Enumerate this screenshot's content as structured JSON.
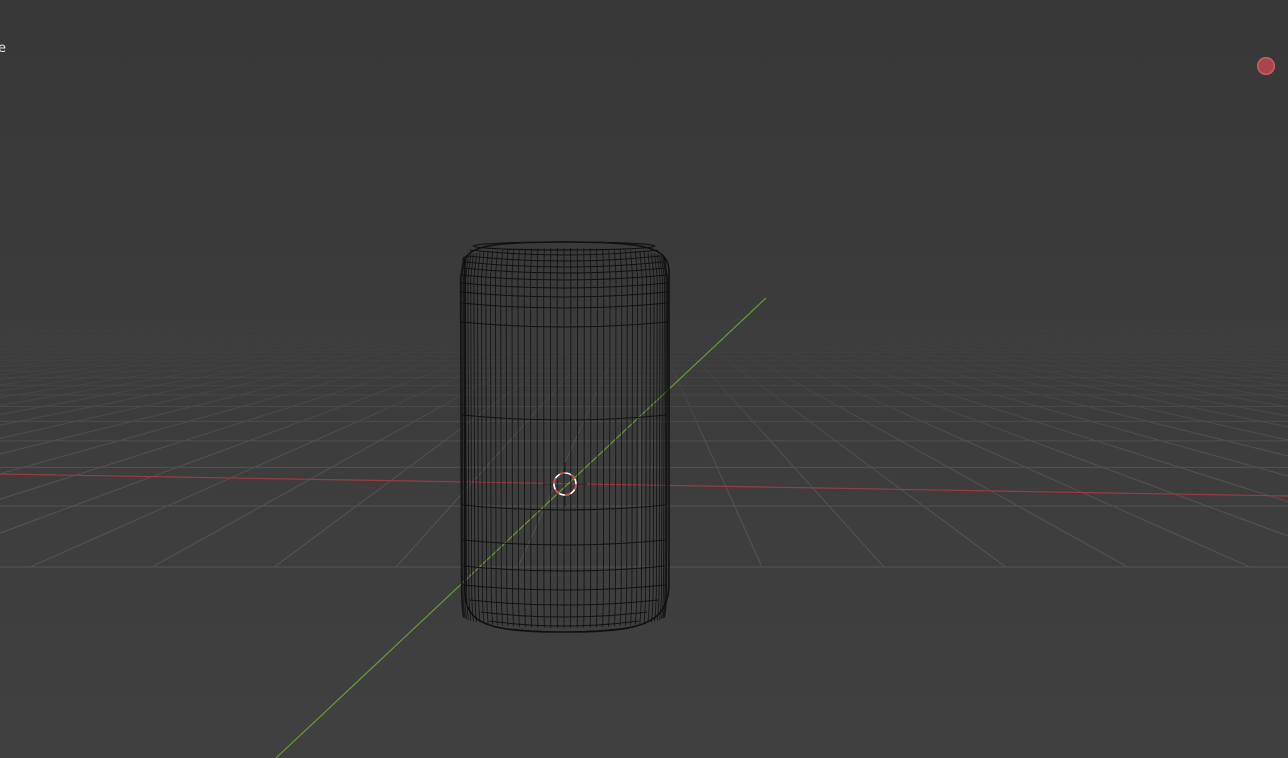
{
  "viewport": {
    "mode_label_fragment": "e",
    "icons": {
      "record_indicator": "record-dot-icon",
      "cursor": "3d-cursor-icon"
    },
    "colors": {
      "background_top": "#383838",
      "background_bottom": "#3f3f3f",
      "grid": "#5a5a5a",
      "x_axis": "#9b3a44",
      "y_axis": "#6a9a3a",
      "wireframe": "#111111",
      "cursor_red": "#d6453f",
      "cursor_white": "#ffffff",
      "record": "#a9434c"
    }
  }
}
